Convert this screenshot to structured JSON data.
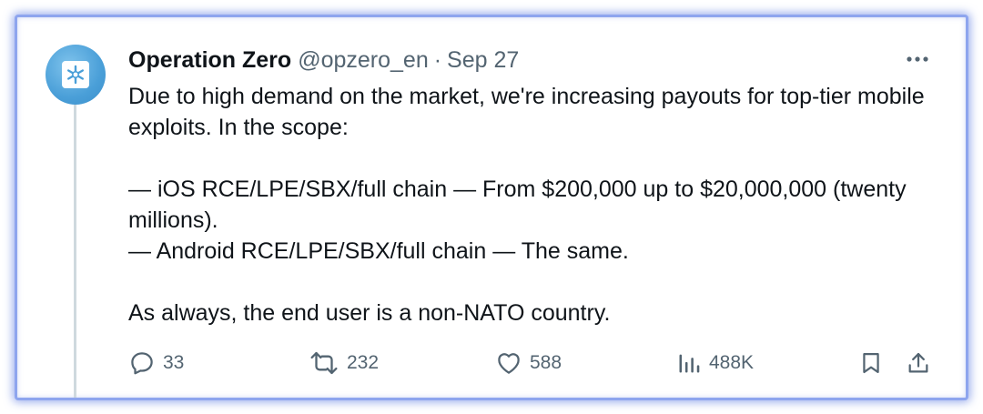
{
  "tweet": {
    "author_name": "Operation Zero",
    "handle": "@opzero_en",
    "separator": "·",
    "date": "Sep 27",
    "more_icon": "more-horizontal-icon",
    "avatar_icon": "snowflake-logo",
    "avatar_colors": {
      "background": "#4a9fd8",
      "mark": "#4a9fd8"
    },
    "body": {
      "line1": "Due to high demand on the market, we're increasing payouts for top-tier mobile exploits. In the scope:",
      "line2": "— iOS RCE/LPE/SBX/full chain — From $200,000 up to $20,000,000 (twenty millions).",
      "line3": "— Android RCE/LPE/SBX/full chain — The same.",
      "line4": "As always, the end user is a non-NATO country."
    },
    "actions": {
      "reply": {
        "icon": "reply-icon",
        "count": "33"
      },
      "retweet": {
        "icon": "retweet-icon",
        "count": "232"
      },
      "like": {
        "icon": "heart-icon",
        "count": "588"
      },
      "views": {
        "icon": "views-icon",
        "count": "488K"
      },
      "bookmark": {
        "icon": "bookmark-icon"
      },
      "share": {
        "icon": "share-icon"
      }
    }
  },
  "colors": {
    "text": "#0f1419",
    "secondary": "#536471",
    "frame_border": "#8ea5ee",
    "thread_line": "#cfd9de"
  }
}
